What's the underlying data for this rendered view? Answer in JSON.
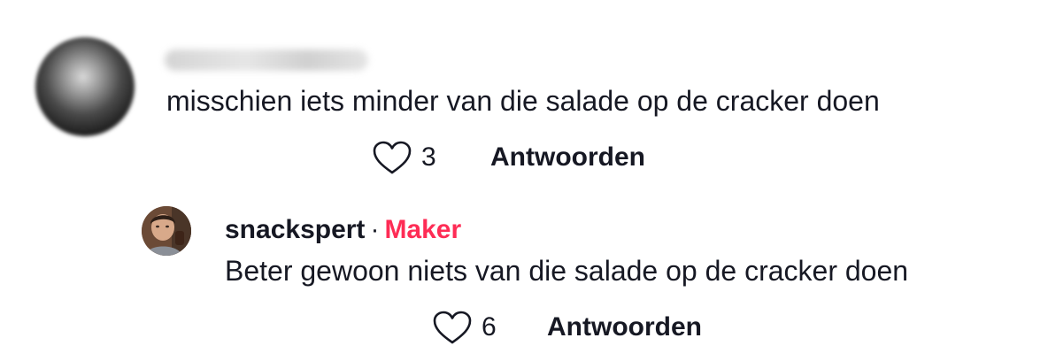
{
  "comment": {
    "text": "misschien iets minder van die salade op de cracker doen",
    "like_count": "3",
    "reply_label": "Antwoorden"
  },
  "reply": {
    "username": "snackspert",
    "separator": "·",
    "badge": "Maker",
    "text": "Beter gewoon niets van die salade op de cracker doen",
    "like_count": "6",
    "reply_label": "Antwoorden"
  },
  "icons": {
    "like": "heart-outline-icon"
  },
  "colors": {
    "text": "#161823",
    "creator_badge": "#fe2c55",
    "background": "#ffffff"
  }
}
